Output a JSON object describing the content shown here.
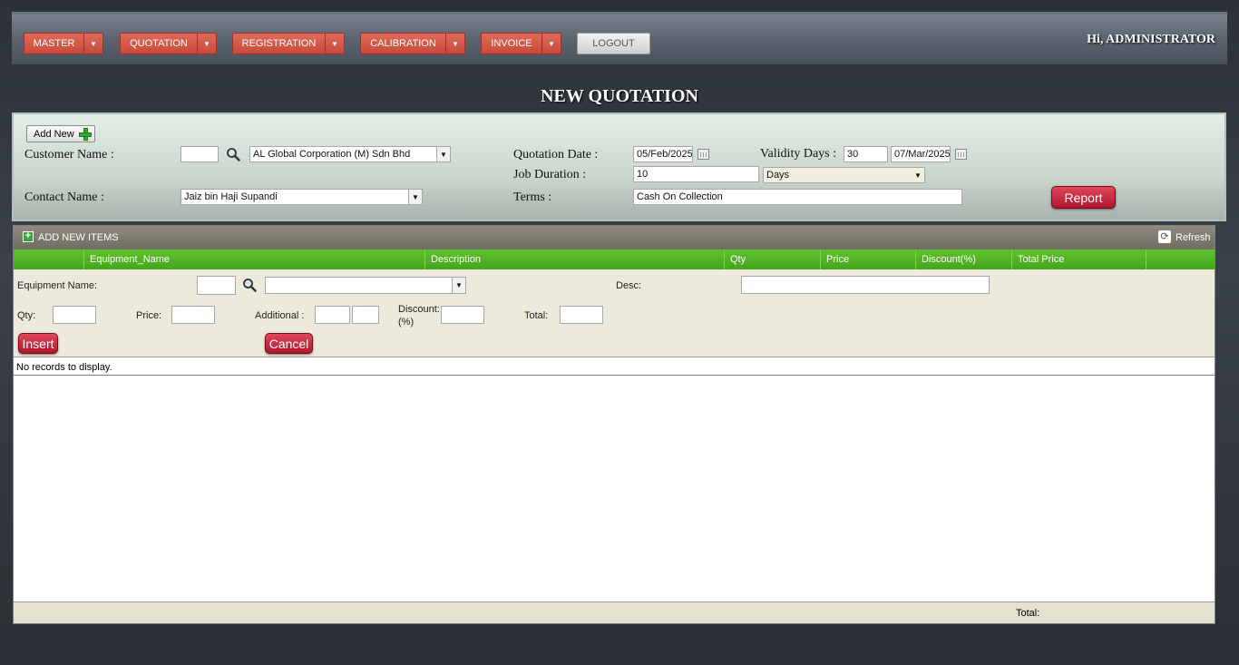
{
  "nav": {
    "items": [
      {
        "label": "MASTER"
      },
      {
        "label": "QUOTATION"
      },
      {
        "label": "REGISTRATION"
      },
      {
        "label": "CALIBRATION"
      },
      {
        "label": "INVOICE"
      }
    ],
    "logout_label": "LOGOUT",
    "greeting": "Hi, ADMINISTRATOR"
  },
  "page_title": "NEW QUOTATION",
  "form": {
    "add_new_label": "Add New",
    "customer_name_label": "Customer Name :",
    "customer_code_value": "",
    "customer_name_value": "AL Global Corporation (M) Sdn Bhd",
    "contact_name_label": "Contact Name :",
    "contact_name_value": "Jaiz bin Haji Supandi",
    "quotation_date_label": "Quotation Date :",
    "quotation_date_value": "05/Feb/2025",
    "validity_days_label": "Validity Days :",
    "validity_days_value": "30",
    "validity_date_value": "07/Mar/2025",
    "job_duration_label": "Job Duration :",
    "job_duration_value": "10",
    "job_duration_unit": "Days",
    "terms_label": "Terms :",
    "terms_value": "Cash On Collection",
    "report_label": "Report"
  },
  "grid": {
    "add_items_label": "ADD NEW ITEMS",
    "refresh_label": "Refresh",
    "columns": [
      "Equipment_Name",
      "Description",
      "Qty",
      "Price",
      "Discount(%)",
      "Total Price"
    ],
    "edit": {
      "equipment_name_label": "Equipment Name:",
      "desc_label": "Desc:",
      "qty_label": "Qty:",
      "price_label": "Price:",
      "additional_label": "Additional :",
      "discount_label_1": "Discount:",
      "discount_label_2": "(%)",
      "total_label": "Total:",
      "insert_label": "Insert",
      "cancel_label": "Cancel"
    },
    "no_records": "No records to display.",
    "footer_total_label": "Total:"
  },
  "colors": {
    "nav_button": "#d85a4b",
    "grid_header": "#52b725",
    "report_button": "#c61e36"
  }
}
